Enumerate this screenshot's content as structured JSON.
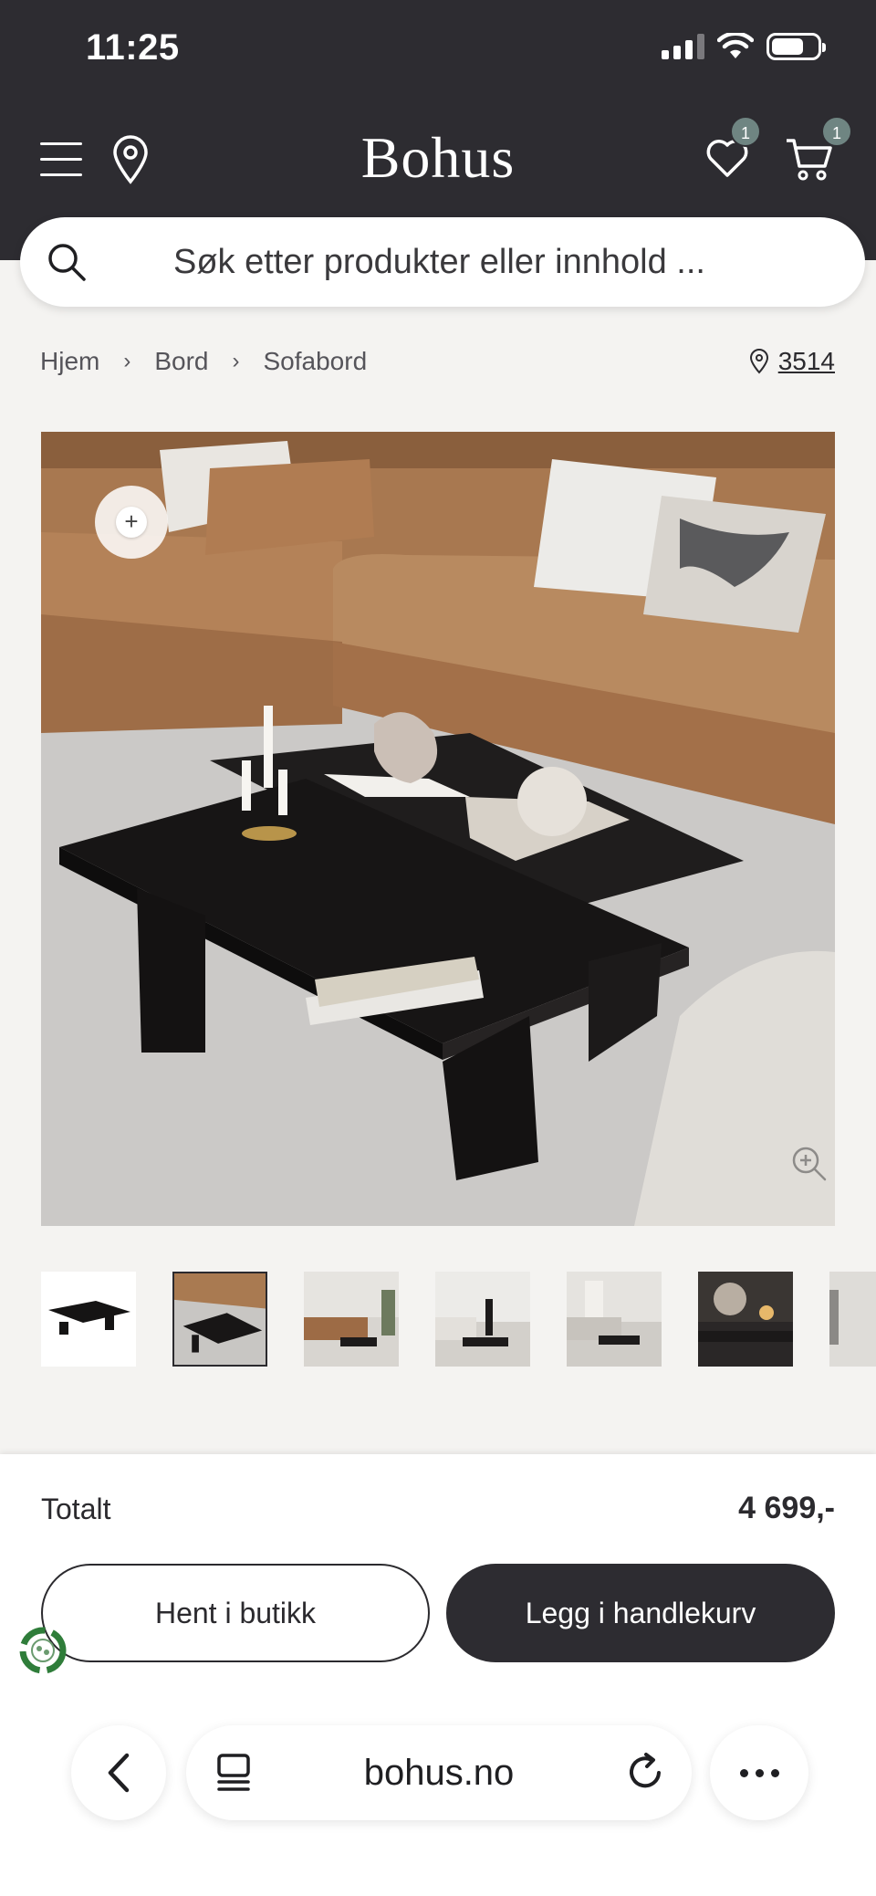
{
  "status_bar": {
    "time": "11:25"
  },
  "header": {
    "brand": "Bohus",
    "wishlist_count": "1",
    "cart_count": "1"
  },
  "search": {
    "placeholder": "Søk etter produkter eller innhold ..."
  },
  "breadcrumb": {
    "items": [
      "Hjem",
      "Bord",
      "Sofabord"
    ],
    "store_number": "3514"
  },
  "product": {
    "thumbnail_count": 7,
    "active_thumbnail": 2
  },
  "purchase": {
    "total_label": "Totalt",
    "total_price": "4 699,-",
    "pickup_button": "Hent i butikk",
    "add_to_cart_button": "Legg i handlekurv"
  },
  "browser": {
    "url": "bohus.no"
  },
  "colors": {
    "header_bg": "#2d2c31",
    "page_bg": "#f4f3f1",
    "badge": "#6f8582",
    "eco_green": "#2f7d3a"
  }
}
